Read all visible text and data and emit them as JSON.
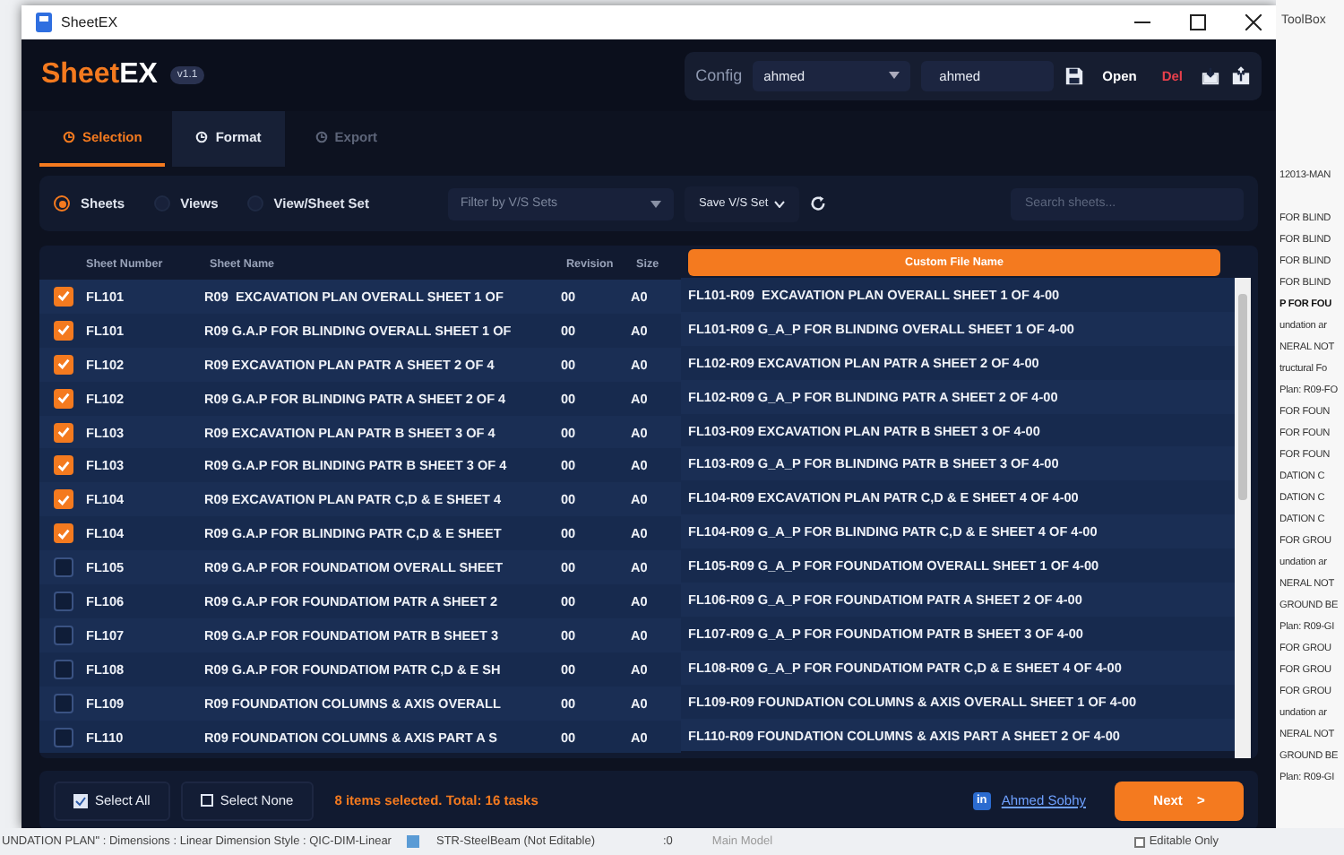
{
  "window": {
    "title": "SheetEX"
  },
  "app": {
    "logo_left": "Sheet",
    "logo_right": "EX",
    "version": "v1.1"
  },
  "config": {
    "label": "Config",
    "profile": "ahmed",
    "name_value": "ahmed",
    "actions": [
      {
        "kind": "save"
      },
      {
        "kind": "text",
        "label": "Open"
      },
      {
        "kind": "danger",
        "label": "Del"
      },
      {
        "kind": "import"
      },
      {
        "kind": "export"
      }
    ]
  },
  "tabs": [
    {
      "label": "Selection",
      "selected": true,
      "disabled": false
    },
    {
      "label": "Format",
      "selected": false,
      "disabled": false
    },
    {
      "label": "Export",
      "selected": false,
      "disabled": true
    }
  ],
  "scope": [
    {
      "label": "Sheets",
      "selected": true
    },
    {
      "label": "Views",
      "selected": false
    },
    {
      "label": "View/Sheet Set",
      "selected": false
    }
  ],
  "filter": {
    "placeholder": "Filter by V/S Sets"
  },
  "save_set": {
    "label": "Save V/S Set"
  },
  "search": {
    "placeholder": "Search sheets..."
  },
  "table": {
    "columns": [
      "Sheet Number",
      "Sheet Name",
      "Revision",
      "Size",
      "Custom File Name"
    ],
    "rows": [
      {
        "checked": true,
        "number": "FL101",
        "name": "R09  EXCAVATION PLAN OVERALL SHEET 1 OF",
        "revision": "00",
        "size": "A0",
        "custom": "FL101-R09  EXCAVATION PLAN OVERALL SHEET 1 OF 4-00"
      },
      {
        "checked": true,
        "number": "FL101",
        "name": "R09 G.A.P FOR BLINDING OVERALL SHEET 1 OF",
        "revision": "00",
        "size": "A0",
        "custom": "FL101-R09 G_A_P FOR BLINDING OVERALL SHEET 1 OF 4-00"
      },
      {
        "checked": true,
        "number": "FL102",
        "name": "R09 EXCAVATION PLAN PATR A SHEET 2 OF 4",
        "revision": "00",
        "size": "A0",
        "custom": "FL102-R09 EXCAVATION PLAN PATR A SHEET 2 OF 4-00"
      },
      {
        "checked": true,
        "number": "FL102",
        "name": "R09 G.A.P FOR BLINDING PATR A SHEET 2 OF 4",
        "revision": "00",
        "size": "A0",
        "custom": "FL102-R09 G_A_P FOR BLINDING PATR A SHEET 2 OF 4-00"
      },
      {
        "checked": true,
        "number": "FL103",
        "name": "R09 EXCAVATION PLAN PATR B SHEET 3 OF 4",
        "revision": "00",
        "size": "A0",
        "custom": "FL103-R09 EXCAVATION PLAN PATR B SHEET 3 OF 4-00"
      },
      {
        "checked": true,
        "number": "FL103",
        "name": "R09 G.A.P FOR BLINDING PATR B SHEET 3 OF 4",
        "revision": "00",
        "size": "A0",
        "custom": "FL103-R09 G_A_P FOR BLINDING PATR B SHEET 3 OF 4-00"
      },
      {
        "checked": true,
        "number": "FL104",
        "name": "R09 EXCAVATION PLAN PATR C,D & E SHEET 4",
        "revision": "00",
        "size": "A0",
        "custom": "FL104-R09 EXCAVATION PLAN PATR C,D & E SHEET 4 OF 4-00"
      },
      {
        "checked": true,
        "number": "FL104",
        "name": "R09 G.A.P FOR BLINDING PATR C,D & E SHEET",
        "revision": "00",
        "size": "A0",
        "custom": "FL104-R09 G_A_P FOR BLINDING PATR C,D & E SHEET 4 OF 4-00"
      },
      {
        "checked": false,
        "number": "FL105",
        "name": "R09 G.A.P FOR FOUNDATIOM OVERALL SHEET",
        "revision": "00",
        "size": "A0",
        "custom": "FL105-R09 G_A_P FOR FOUNDATIOM OVERALL SHEET 1 OF 4-00"
      },
      {
        "checked": false,
        "number": "FL106",
        "name": "R09 G.A.P FOR FOUNDATIOM PATR A SHEET 2",
        "revision": "00",
        "size": "A0",
        "custom": "FL106-R09 G_A_P FOR FOUNDATIOM PATR A SHEET 2 OF 4-00"
      },
      {
        "checked": false,
        "number": "FL107",
        "name": "R09 G.A.P FOR FOUNDATIOM PATR B SHEET 3",
        "revision": "00",
        "size": "A0",
        "custom": "FL107-R09 G_A_P FOR FOUNDATIOM PATR B SHEET 3 OF 4-00"
      },
      {
        "checked": false,
        "number": "FL108",
        "name": "R09 G.A.P FOR FOUNDATIOM PATR C,D & E SH",
        "revision": "00",
        "size": "A0",
        "custom": "FL108-R09 G_A_P FOR FOUNDATIOM PATR C,D & E SHEET 4 OF 4-00"
      },
      {
        "checked": false,
        "number": "FL109",
        "name": "R09 FOUNDATION COLUMNS & AXIS OVERALL",
        "revision": "00",
        "size": "A0",
        "custom": "FL109-R09 FOUNDATION COLUMNS & AXIS OVERALL SHEET 1 OF 4-00"
      },
      {
        "checked": false,
        "number": "FL110",
        "name": "R09 FOUNDATION COLUMNS & AXIS PART A S",
        "revision": "00",
        "size": "A0",
        "custom": "FL110-R09 FOUNDATION COLUMNS & AXIS PART A SHEET 2 OF 4-00"
      }
    ]
  },
  "footer": {
    "select_all": "Select All",
    "select_none": "Select None",
    "status": "8 items selected. Total: 16 tasks",
    "badge": "in",
    "author": "Ahmed Sobhy",
    "next": "Next",
    "next_arrow": ">"
  },
  "desktop": {
    "toolbox": "ToolBox",
    "side_lines": [
      {
        "kind": "text",
        "text": "12013-MAN"
      },
      {
        "kind": "gap"
      },
      {
        "kind": "text",
        "text": "FOR BLIND"
      },
      {
        "kind": "text",
        "text": "FOR BLIND"
      },
      {
        "kind": "text",
        "text": "FOR BLIND"
      },
      {
        "kind": "text",
        "text": "FOR BLIND"
      },
      {
        "kind": "heading",
        "text": "P FOR FOU"
      },
      {
        "kind": "text",
        "text": "undation ar"
      },
      {
        "kind": "text",
        "text": "NERAL NOT"
      },
      {
        "kind": "text",
        "text": "tructural Fo"
      },
      {
        "kind": "text",
        "text": "Plan: R09-FO"
      },
      {
        "kind": "text",
        "text": "FOR FOUN"
      },
      {
        "kind": "text",
        "text": "FOR FOUN"
      },
      {
        "kind": "text",
        "text": "FOR FOUN"
      },
      {
        "kind": "text",
        "text": "DATION C"
      },
      {
        "kind": "text",
        "text": "DATION C"
      },
      {
        "kind": "text",
        "text": "DATION C"
      },
      {
        "kind": "text",
        "text": "FOR GROU"
      },
      {
        "kind": "text",
        "text": "undation ar"
      },
      {
        "kind": "text",
        "text": "NERAL NOT"
      },
      {
        "kind": "text",
        "text": "GROUND BE"
      },
      {
        "kind": "text",
        "text": "Plan: R09-GI"
      },
      {
        "kind": "text",
        "text": "FOR GROU"
      },
      {
        "kind": "text",
        "text": "FOR GROU"
      },
      {
        "kind": "text",
        "text": "FOR GROU"
      },
      {
        "kind": "text",
        "text": "undation ar"
      },
      {
        "kind": "text",
        "text": "NERAL NOT"
      },
      {
        "kind": "text",
        "text": "GROUND BE"
      },
      {
        "kind": "text",
        "text": "Plan: R09-GI"
      }
    ],
    "status_text": "UNDATION PLAN\" : Dimensions : Linear Dimension Style : QIC-DIM-Linear",
    "status_type": "STR-SteelBeam (Not Editable)",
    "status_count": ":0",
    "status_model": "Main Model",
    "status_editable": "Editable Only",
    "editable_checked": false
  }
}
